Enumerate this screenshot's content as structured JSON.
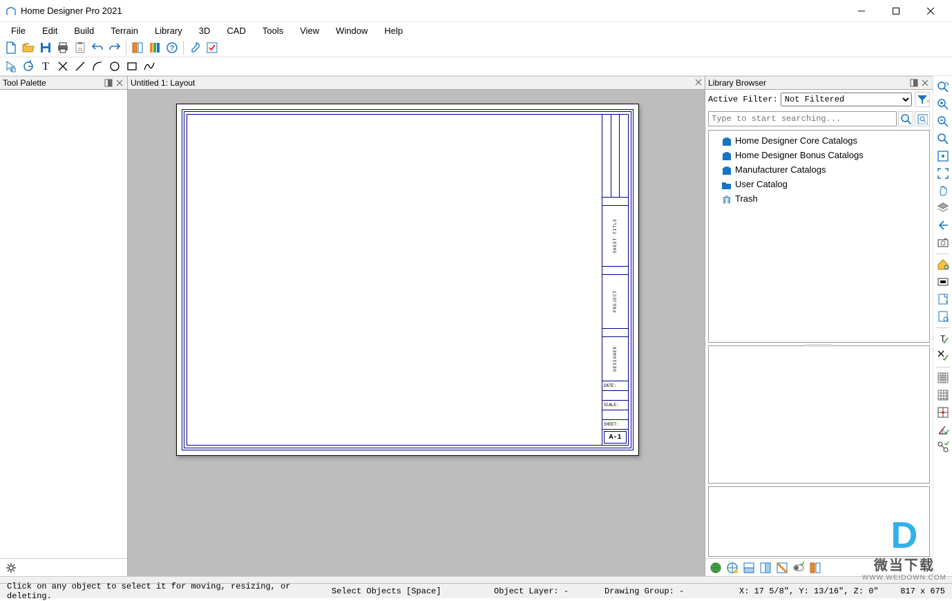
{
  "app": {
    "title": "Home Designer Pro 2021"
  },
  "menu": {
    "items": [
      "File",
      "Edit",
      "Build",
      "Terrain",
      "Library",
      "3D",
      "CAD",
      "Tools",
      "View",
      "Window",
      "Help"
    ]
  },
  "palette": {
    "title": "Tool Palette"
  },
  "document": {
    "tab": "Untitled 1: Layout"
  },
  "titleblock": {
    "sheet_title": "SHEET TITLE",
    "project": "PROJECT",
    "designer": "DESIGNER",
    "date_label": "DATE:",
    "scale_label": "SCALE:",
    "sheet_label": "SHEET:",
    "sheet_no": "A-1"
  },
  "library": {
    "title": "Library Browser",
    "filter_label": "Active Filter:",
    "filter_value": "Not Filtered",
    "search_placeholder": "Type to start searching...",
    "tree": [
      {
        "label": "Home Designer Core Catalogs",
        "icon": "catalog"
      },
      {
        "label": "Home Designer Bonus Catalogs",
        "icon": "catalog"
      },
      {
        "label": "Manufacturer Catalogs",
        "icon": "catalog"
      },
      {
        "label": "User Catalog",
        "icon": "folder"
      },
      {
        "label": "Trash",
        "icon": "trash"
      }
    ]
  },
  "status": {
    "hint": "Click on any object to select it for moving, resizing, or deleting.",
    "mode": "Select Objects [Space]",
    "layer": "Object Layer: -",
    "group": "Drawing Group: -",
    "coords": "X: 17 5/8\", Y: 13/16\", Z: 0\"",
    "dims": "817 x 675"
  },
  "watermark": {
    "logo_char": "D",
    "cn": "微当下载",
    "url": "WWW.WEIDOWN.COM"
  }
}
